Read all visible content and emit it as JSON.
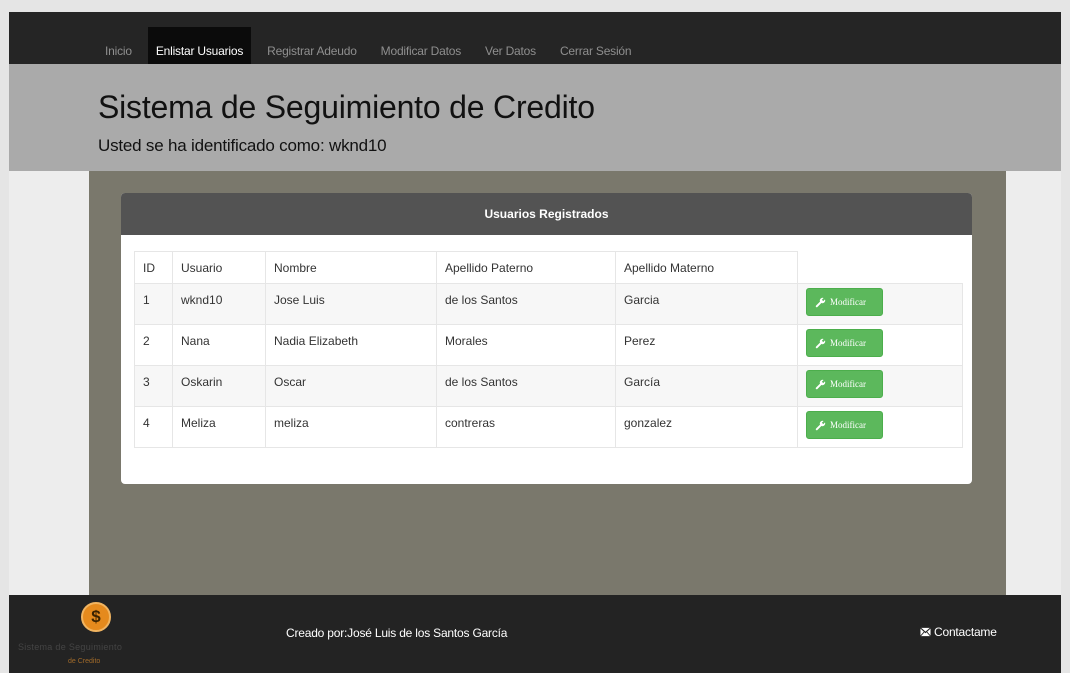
{
  "nav": {
    "items": [
      {
        "label": "Inicio"
      },
      {
        "label": "Enlistar Usuarios",
        "active": true
      },
      {
        "label": "Registrar Adeudo"
      },
      {
        "label": "Modificar Datos"
      },
      {
        "label": "Ver Datos"
      },
      {
        "label": "Cerrar Sesión"
      }
    ]
  },
  "header": {
    "title": "Sistema de Seguimiento de Credito",
    "subtitle": "Usted se ha identificado como: wknd10"
  },
  "panel": {
    "title": "Usuarios Registrados",
    "columns": [
      "ID",
      "Usuario",
      "Nombre",
      "Apellido Paterno",
      "Apellido Materno"
    ],
    "rows": [
      {
        "id": "1",
        "usuario": "wknd10",
        "nombre": "Jose Luis",
        "apellido_paterno": "de los Santos",
        "apellido_materno": "Garcia"
      },
      {
        "id": "2",
        "usuario": "Nana",
        "nombre": "Nadia Elizabeth",
        "apellido_paterno": "Morales",
        "apellido_materno": "Perez"
      },
      {
        "id": "3",
        "usuario": "Oskarin",
        "nombre": "Oscar",
        "apellido_paterno": "de los Santos",
        "apellido_materno": "García"
      },
      {
        "id": "4",
        "usuario": "Meliza",
        "nombre": "meliza",
        "apellido_paterno": "contreras",
        "apellido_materno": "gonzalez"
      }
    ],
    "action_label": "Modificar",
    "action_icon": "wrench-icon"
  },
  "footer": {
    "logo_line1": "Sistema de Seguimiento",
    "logo_line2": "de Credito",
    "logo_icon": "dollar-coin-icon",
    "credit": "Creado por:José Luis de los Santos García",
    "contact_label": "Contactame",
    "contact_icon": "envelope-icon"
  },
  "colors": {
    "navbar": "#252525",
    "header_band": "#aaaaaa",
    "content_bg": "#7a786c",
    "panel_header": "#535353",
    "button_green": "#5cb85c",
    "footer": "#232323",
    "logo_orange": "#e58a1d"
  }
}
